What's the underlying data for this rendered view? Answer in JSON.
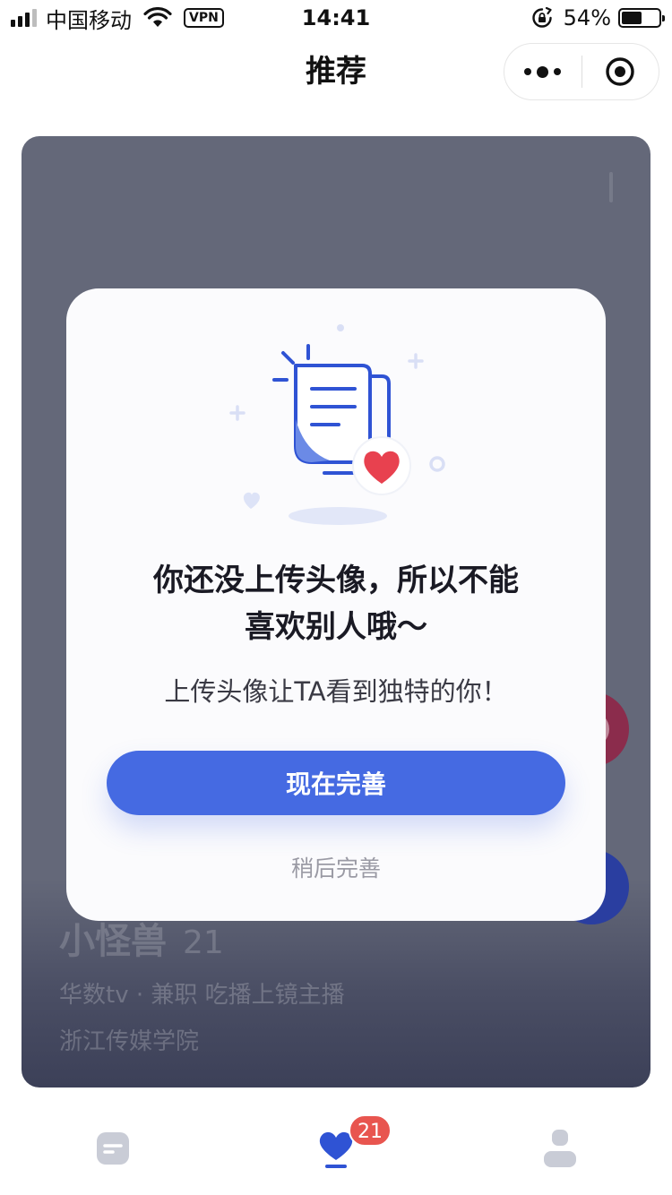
{
  "status_bar": {
    "carrier": "中国移动",
    "vpn": "VPN",
    "time": "14:41",
    "battery_percent": "54%",
    "battery_level": 0.54
  },
  "nav": {
    "title": "推荐",
    "more_icon": "more-dots-icon",
    "close_icon": "target-circle-icon"
  },
  "profile": {
    "name": "小怪兽",
    "age": "21",
    "job": "华数tv · 兼职 吃播上镜主播",
    "school": "浙江传媒学院"
  },
  "modal": {
    "title_line1": "你还没上传头像，所以不能",
    "title_line2": "喜欢别人哦～",
    "subtitle": "上传头像让TA看到独特的你！",
    "primary_button": "现在完善",
    "secondary_link": "稍后完善"
  },
  "tabbar": {
    "items": [
      {
        "icon": "home-chat-icon",
        "active": false
      },
      {
        "icon": "heart-icon",
        "active": true,
        "badge": "21"
      },
      {
        "icon": "user-icon",
        "active": false
      }
    ]
  },
  "colors": {
    "accent": "#456ae2",
    "badge": "#e8554f",
    "heart": "#e8414f",
    "card": "#646879"
  }
}
